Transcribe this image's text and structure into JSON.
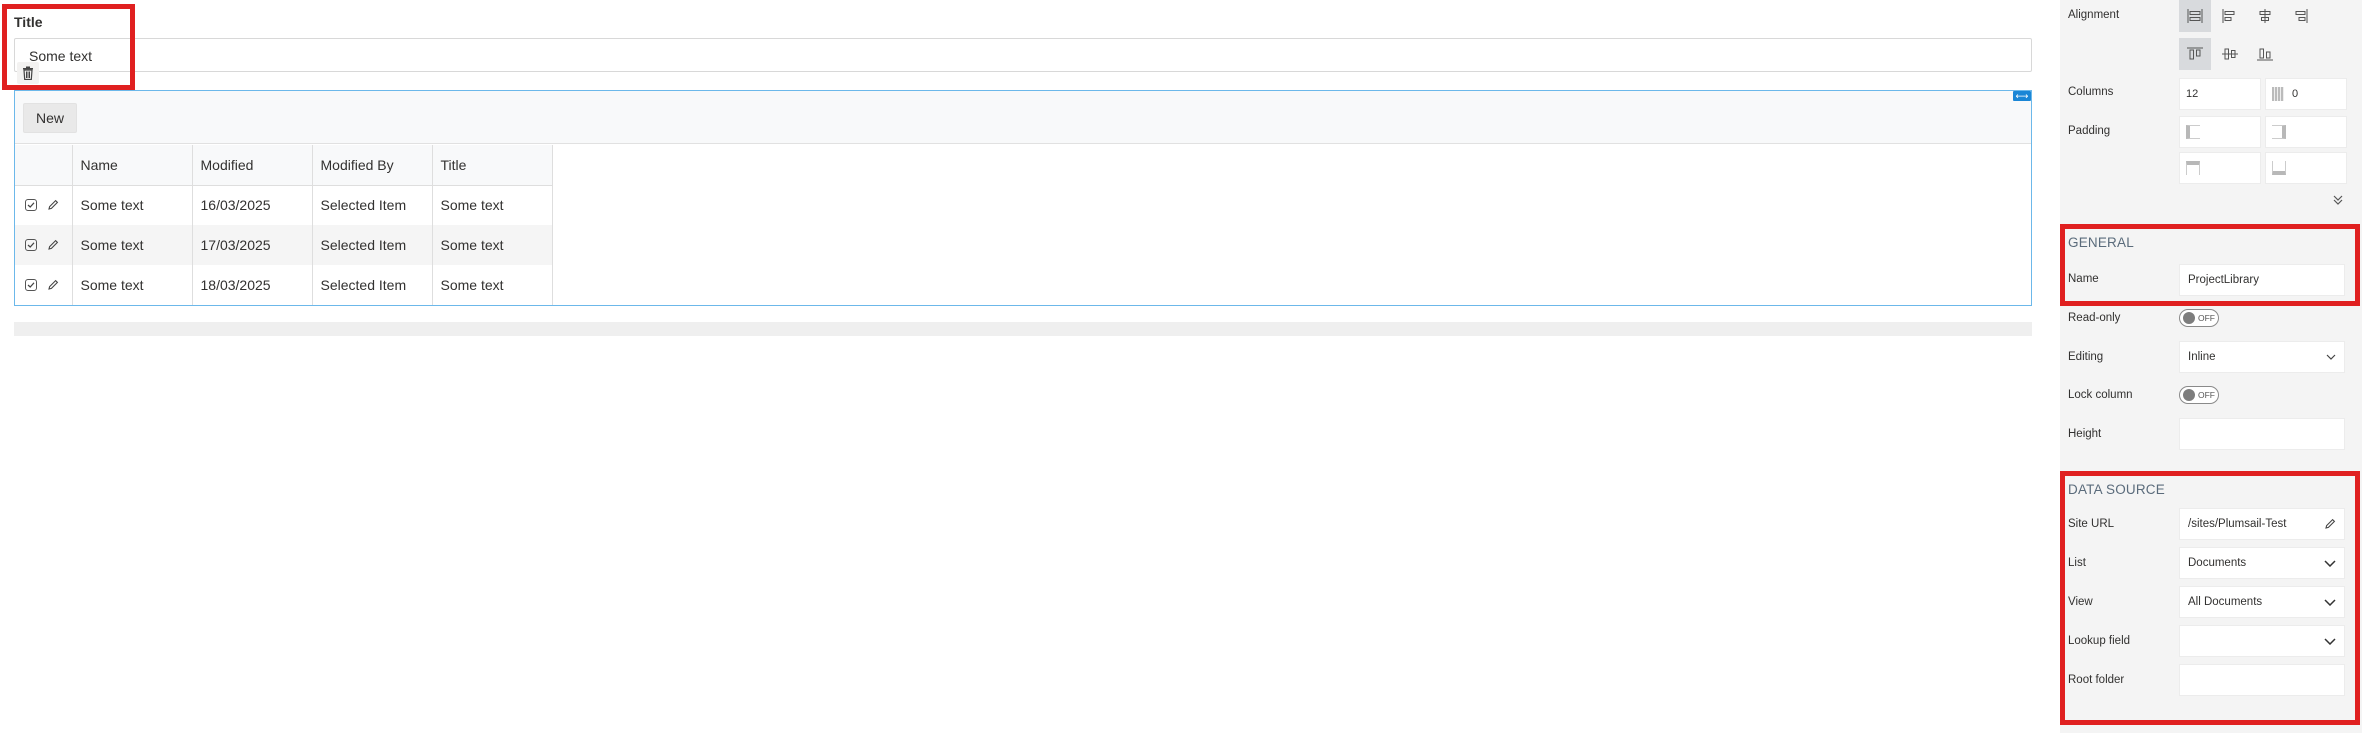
{
  "form": {
    "title_label": "Title",
    "title_value": "Some text"
  },
  "grid": {
    "new_label": "New",
    "columns": [
      "Name",
      "Modified",
      "Modified By",
      "Title"
    ],
    "rows": [
      {
        "name": "Some text",
        "modified": "16/03/2025",
        "modified_by": "Selected Item",
        "title": "Some text"
      },
      {
        "name": "Some text",
        "modified": "17/03/2025",
        "modified_by": "Selected Item",
        "title": "Some text"
      },
      {
        "name": "Some text",
        "modified": "18/03/2025",
        "modified_by": "Selected Item",
        "title": "Some text"
      }
    ]
  },
  "panel": {
    "alignment_label": "Alignment",
    "columns_label": "Columns",
    "columns_value": "12",
    "offset_value": "0",
    "padding_label": "Padding",
    "general": {
      "title": "GENERAL",
      "name_label": "Name",
      "name_value": "ProjectLibrary",
      "readonly_label": "Read-only",
      "readonly_state": "OFF",
      "editing_label": "Editing",
      "editing_value": "Inline",
      "lock_label": "Lock column",
      "lock_state": "OFF",
      "height_label": "Height",
      "height_value": ""
    },
    "datasource": {
      "title": "DATA SOURCE",
      "site_label": "Site URL",
      "site_value": "/sites/Plumsail-Test",
      "list_label": "List",
      "list_value": "Documents",
      "view_label": "View",
      "view_value": "All Documents",
      "lookup_label": "Lookup field",
      "lookup_value": "",
      "root_label": "Root folder",
      "root_value": ""
    }
  },
  "colors": {
    "highlight_red": "#e02020",
    "selection_blue": "#6cb8ea",
    "panel_bg": "#f4f4f4",
    "section_title": "#5a6b7b"
  }
}
